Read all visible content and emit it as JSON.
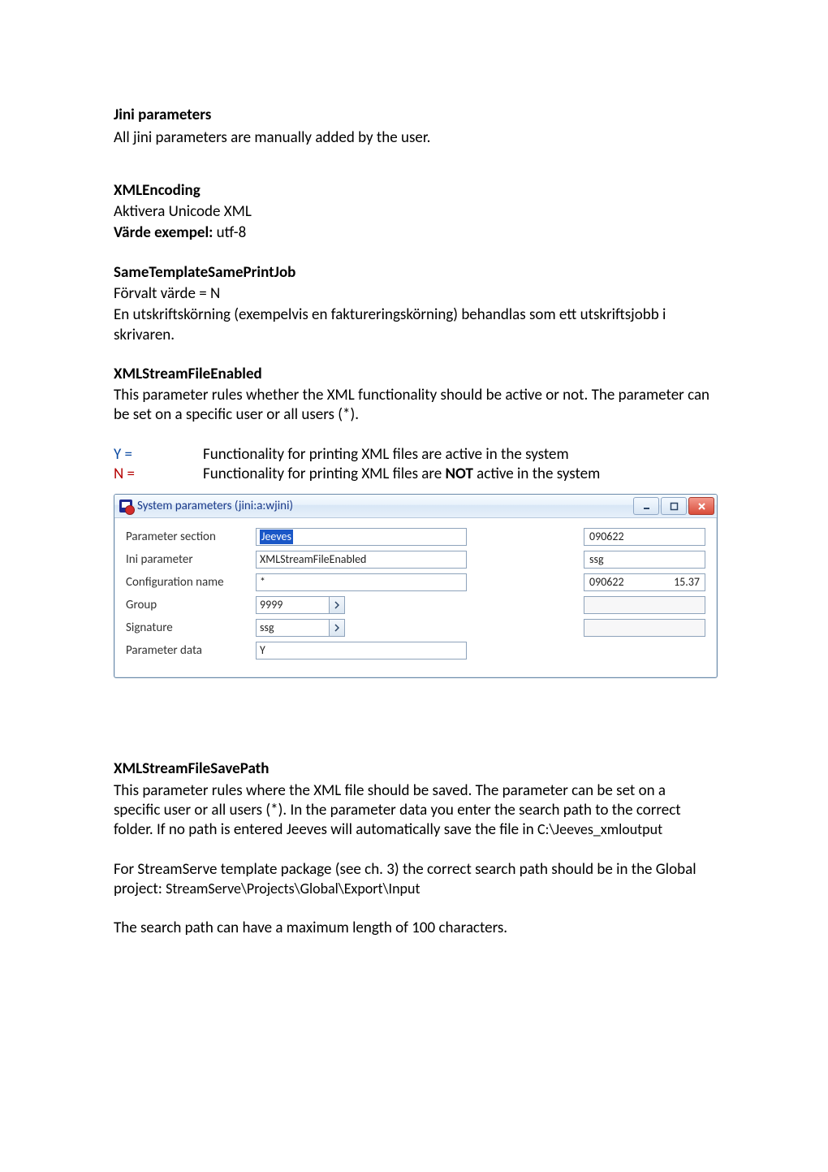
{
  "sections": {
    "jini": {
      "heading": "Jini parameters",
      "text1": "All jini parameters are manually added by the user."
    },
    "xmlencoding": {
      "heading": "XMLEncoding",
      "line1": "Aktivera Unicode XML",
      "value_label": "Värde exempel:",
      "value": " utf-8"
    },
    "sametemplate": {
      "heading": "SameTemplateSamePrintJob",
      "line1": "Förvalt värde = N",
      "line2": "En utskriftskörning (exempelvis en faktureringskörning) behandlas som ett utskriftsjobb i skrivaren."
    },
    "xmlstream_enabled": {
      "heading": "XMLStreamFileEnabled",
      "para": "This parameter rules whether the XML functionality should be active or not. The parameter can be set on a specific user or all users (*).",
      "y_key": "Y  =",
      "y_val": "Functionality for printing XML files are active in the system",
      "n_key": "N  =",
      "n_val_pre": "Functionality for printing XML files are ",
      "n_val_bold": "NOT",
      "n_val_post": " active in the system"
    },
    "xmlstream_path": {
      "heading": "XMLStreamFileSavePath",
      "p1_pre": "This parameter rules where the XML file should be saved. The parameter can be set on a specific user or all users (*). In the parameter data you enter the search path to the correct folder. If no path is entered Jeeves will automatically save the file in ",
      "p1_mono": "C:\\Jeeves_xmloutput",
      "p2_pre": "For StreamServe template package (see ch. 3) the correct search path should be in the Global project: ",
      "p2_mono": "StreamServe\\Projects\\Global\\Export\\Input",
      "p3": "The search path can have a maximum length of 100 characters."
    }
  },
  "window": {
    "title": "System parameters (jini:a:wjini)",
    "labels": {
      "parameter_section": "Parameter section",
      "ini_parameter": "Ini parameter",
      "configuration_name": "Configuration name",
      "group": "Group",
      "signature": "Signature",
      "parameter_data": "Parameter data"
    },
    "values": {
      "parameter_section": "Jeeves",
      "ini_parameter": "XMLStreamFileEnabled",
      "configuration_name": "*",
      "group": "9999",
      "signature": "ssg",
      "parameter_data": "Y"
    },
    "aux": {
      "a1": "090622",
      "a2": "ssg",
      "a3_left": "090622",
      "a3_right": "15.37"
    }
  }
}
